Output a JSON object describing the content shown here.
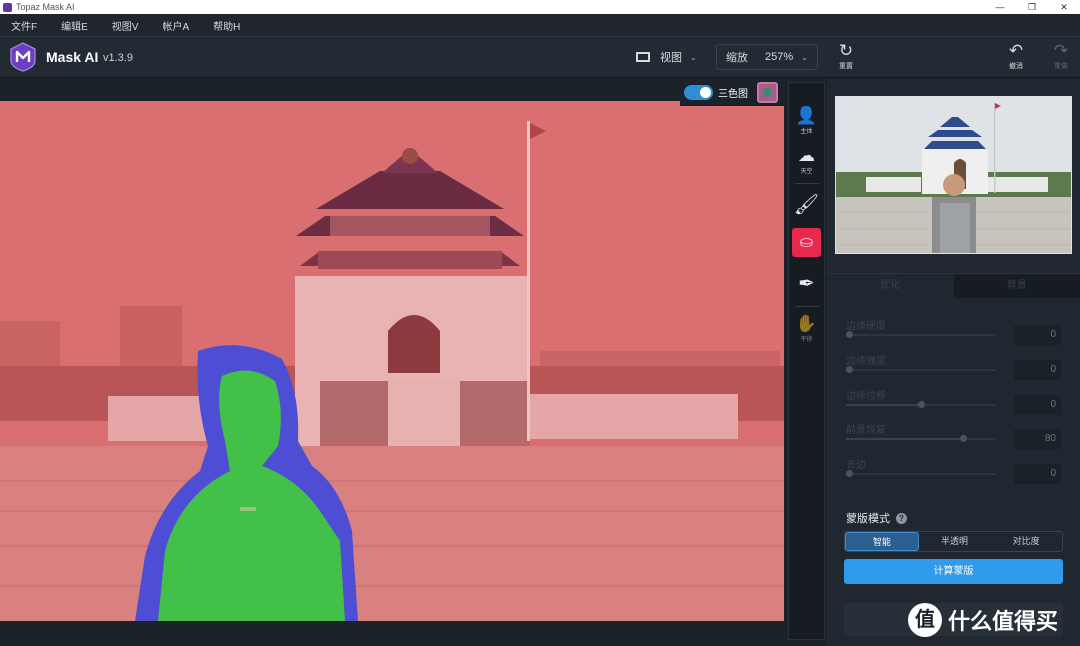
{
  "window": {
    "title": "Topaz Mask AI",
    "controls": [
      "—",
      "❐",
      "✕"
    ]
  },
  "menu": [
    {
      "label": "文件F"
    },
    {
      "label": "编辑E"
    },
    {
      "label": "视图V"
    },
    {
      "label": "帐户A"
    },
    {
      "label": "帮助H"
    }
  ],
  "toolbar": {
    "brand": "Mask AI",
    "version": "v1.3.9",
    "view_label": "视图",
    "zoom_label": "缩放",
    "zoom_value": "257%",
    "reset_label": "重置",
    "undo_label": "撤消",
    "redo_label": "重做"
  },
  "canvas": {
    "trimap_label": "三色图",
    "trimap_enabled": true
  },
  "tools": [
    {
      "name": "subject",
      "label": "主体"
    },
    {
      "name": "sky",
      "label": "天空"
    },
    {
      "name": "brush",
      "label": ""
    },
    {
      "name": "fill",
      "label": ""
    },
    {
      "name": "eyedropper",
      "label": ""
    },
    {
      "name": "pan",
      "label": "平移"
    }
  ],
  "panel": {
    "tabs": [
      "优化",
      "背景"
    ],
    "sliders": [
      {
        "label": "边缘硬度",
        "value": "0",
        "level": 0.0
      },
      {
        "label": "边缘强度",
        "value": "0",
        "level": 0.0
      },
      {
        "label": "边缘位移",
        "value": "0",
        "level": 0.5
      },
      {
        "label": "前景恢复",
        "value": "80",
        "level": 0.8
      },
      {
        "label": "去边",
        "value": "0",
        "level": 0.0
      }
    ],
    "mask_mode_title": "蒙版模式",
    "modes": [
      "智能",
      "半透明",
      "对比度"
    ],
    "compute_label": "计算蒙版"
  },
  "watermark": {
    "badge": "值",
    "text": "什么值得买"
  },
  "colors": {
    "accent": "#2f9bea",
    "tool_active": "#e8294f",
    "bg_overlay": "#d97070",
    "fg_overlay": "#3ec24a",
    "unknown_overlay": "#4a4ad6"
  }
}
